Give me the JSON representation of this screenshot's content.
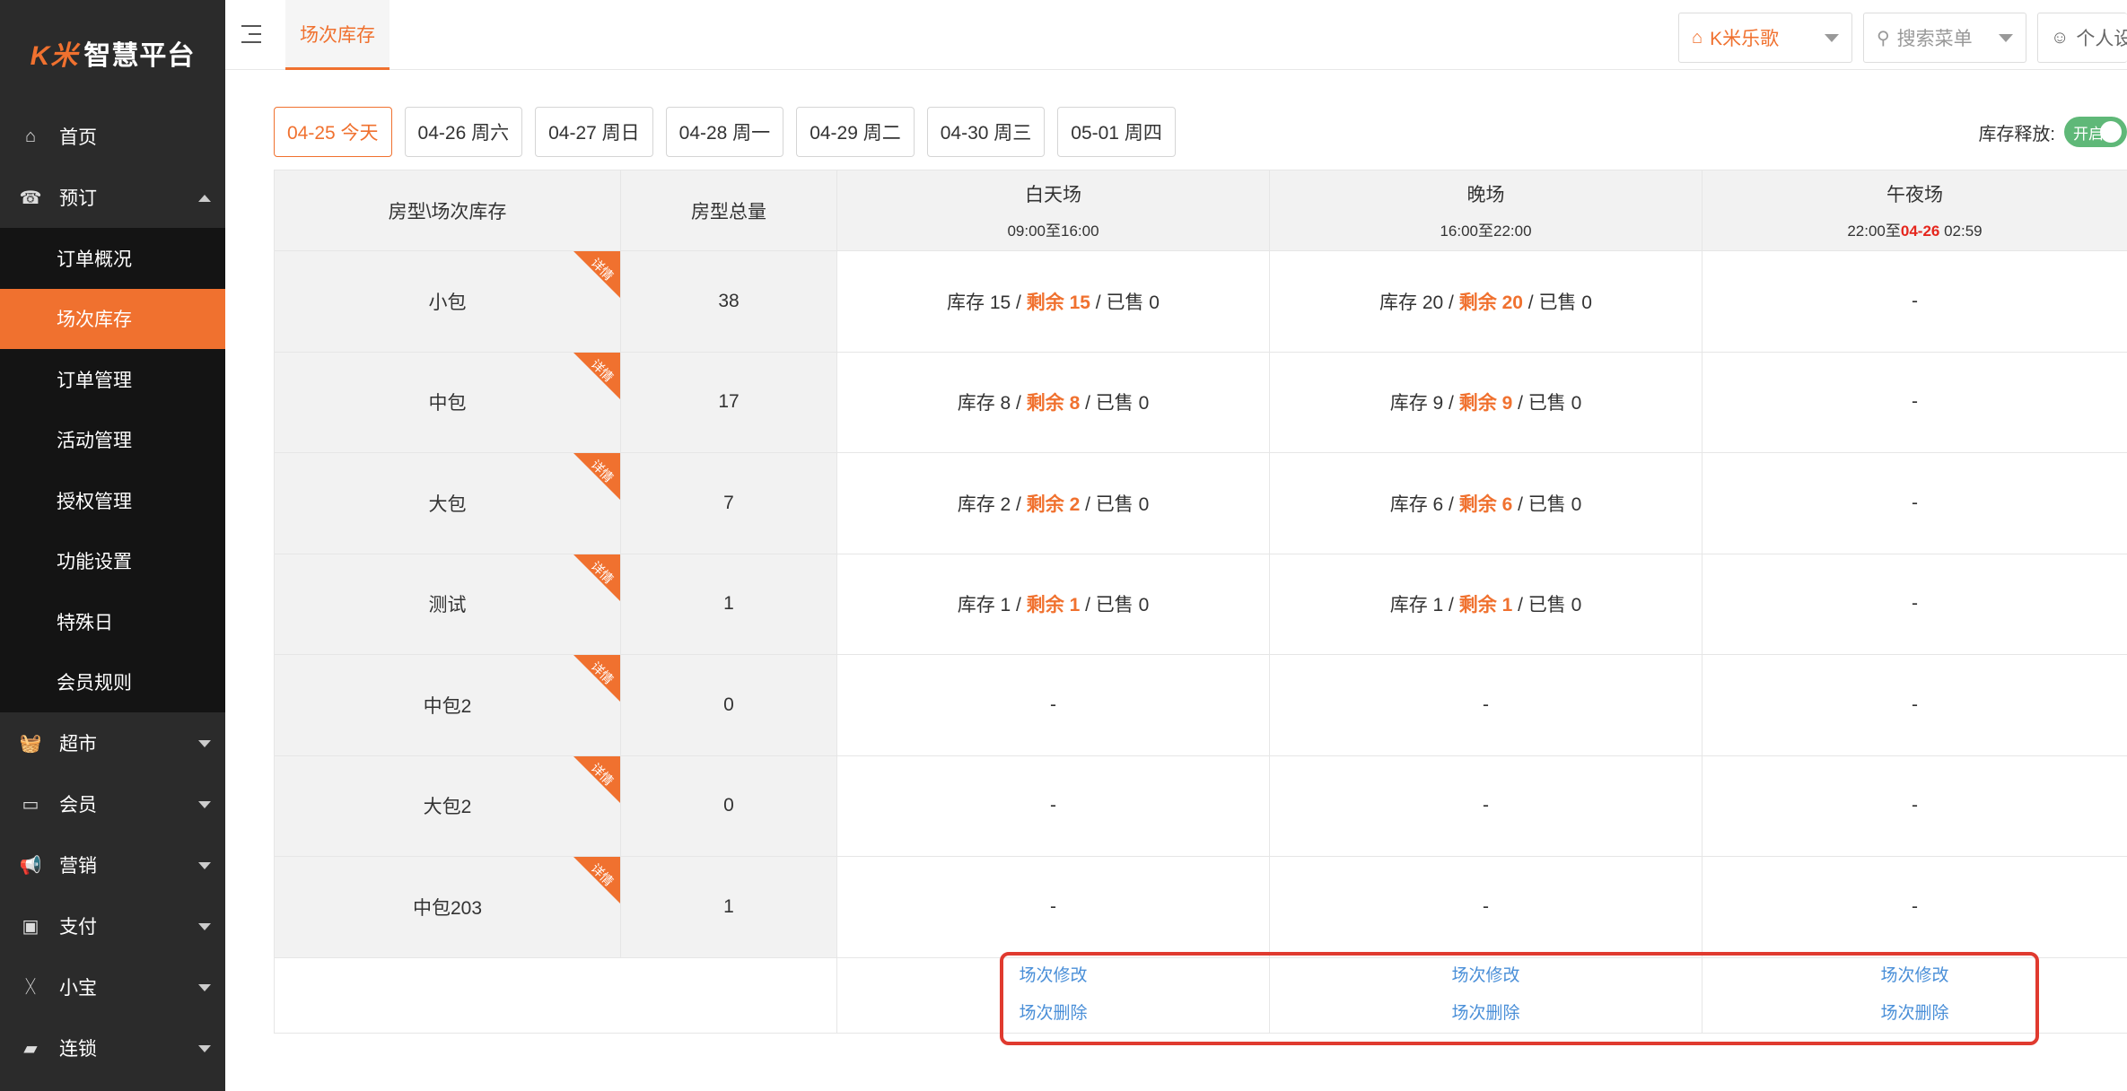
{
  "brand": {
    "mark": "K米",
    "name": "智慧平台"
  },
  "sidebar": {
    "items": [
      {
        "label": "首页",
        "icon": "home-icon",
        "glyph": "⌂"
      },
      {
        "label": "预订",
        "icon": "phone-icon",
        "glyph": "☎"
      },
      {
        "label": "超市",
        "icon": "basket-icon",
        "glyph": "🧺"
      },
      {
        "label": "会员",
        "icon": "card-icon",
        "glyph": "▭"
      },
      {
        "label": "营销",
        "icon": "megaphone-icon",
        "glyph": "📢"
      },
      {
        "label": "支付",
        "icon": "money-icon",
        "glyph": "▣"
      },
      {
        "label": "小宝",
        "icon": "xiaobao-icon",
        "glyph": "ᚷ"
      },
      {
        "label": "连锁",
        "icon": "bag-icon",
        "glyph": "▰"
      }
    ],
    "sub_items": [
      "订单概况",
      "场次库存",
      "订单管理",
      "活动管理",
      "授权管理",
      "功能设置",
      "特殊日",
      "会员规则"
    ]
  },
  "topbar": {
    "tab": "场次库存",
    "store": "K米乐歌",
    "search_placeholder": "搜索菜单",
    "profile": "个人设"
  },
  "dates": [
    "04-25 今天",
    "04-26 周六",
    "04-27 周日",
    "04-28 周一",
    "04-29 周二",
    "04-30 周三",
    "05-01 周四"
  ],
  "release": {
    "label": "库存释放:",
    "toggle": "开启"
  },
  "table": {
    "headers": {
      "room": "房型\\场次库存",
      "total": "房型总量",
      "day": {
        "name": "白天场",
        "time": "09:00至16:00"
      },
      "night": {
        "name": "晚场",
        "time": "16:00至22:00"
      },
      "midnight": {
        "name": "午夜场",
        "time_start": "22:00至",
        "time_date": "04-26",
        "time_end": " 02:59"
      }
    },
    "corner_label": "详情",
    "rows": [
      {
        "room": "小包",
        "total": "38",
        "day": {
          "stock": "库存 15 / ",
          "remain": "剩余 15",
          "sold": " / 已售 0"
        },
        "night": {
          "stock": "库存 20 / ",
          "remain": "剩余 20",
          "sold": " / 已售 0"
        },
        "midnight": "-"
      },
      {
        "room": "中包",
        "total": "17",
        "day": {
          "stock": "库存 8 / ",
          "remain": "剩余 8",
          "sold": " / 已售 0"
        },
        "night": {
          "stock": "库存 9 / ",
          "remain": "剩余 9",
          "sold": " / 已售 0"
        },
        "midnight": "-"
      },
      {
        "room": "大包",
        "total": "7",
        "day": {
          "stock": "库存 2 / ",
          "remain": "剩余 2",
          "sold": " / 已售 0"
        },
        "night": {
          "stock": "库存 6 / ",
          "remain": "剩余 6",
          "sold": " / 已售 0"
        },
        "midnight": "-"
      },
      {
        "room": "测试",
        "total": "1",
        "day": {
          "stock": "库存 1 / ",
          "remain": "剩余 1",
          "sold": " / 已售 0"
        },
        "night": {
          "stock": "库存 1 / ",
          "remain": "剩余 1",
          "sold": " / 已售 0"
        },
        "midnight": "-"
      },
      {
        "room": "中包2",
        "total": "0",
        "day": "-",
        "night": "-",
        "midnight": "-"
      },
      {
        "room": "大包2",
        "total": "0",
        "day": "-",
        "night": "-",
        "midnight": "-"
      },
      {
        "room": "中包203",
        "total": "1",
        "day": "-",
        "night": "-",
        "midnight": "-"
      }
    ],
    "actions": {
      "edit": "场次修改",
      "delete": "场次删除"
    }
  }
}
